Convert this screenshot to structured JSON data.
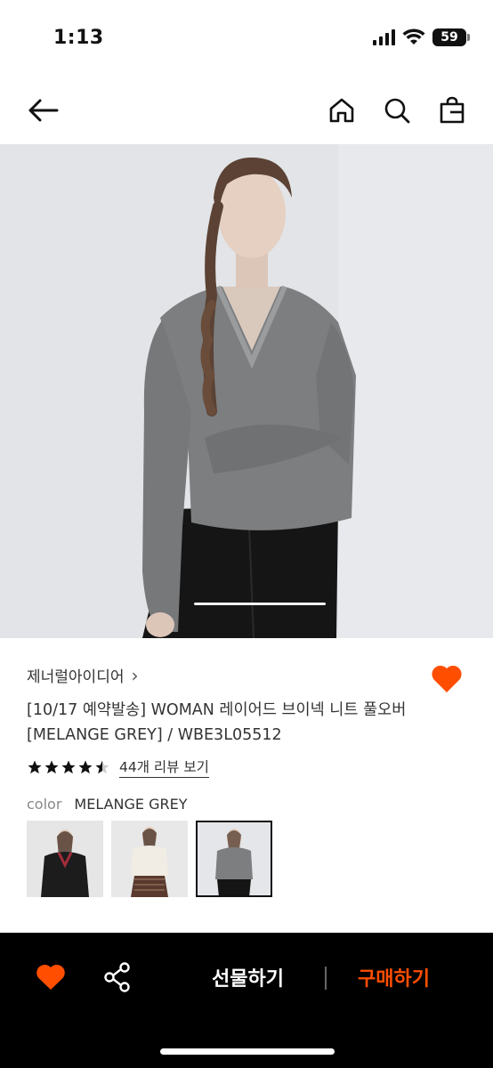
{
  "status_bar": {
    "time": "1:13",
    "battery": "59",
    "icons": [
      "signal-icon",
      "wifi-icon",
      "battery-icon"
    ]
  },
  "nav": {
    "icons": [
      "back-arrow-icon",
      "home-icon",
      "search-icon",
      "shopping-bag-icon"
    ]
  },
  "product": {
    "brand": "제너럴아이디어",
    "brand_chevron": "›",
    "title": "[10/17 예약발송] WOMAN 레이어드 브이넥 니트 풀오버 [MELANGE GREY] / WBE3L05512",
    "rating": 4.5,
    "review_link": "44개 리뷰 보기",
    "color_label": "color",
    "color_value": "MELANGE GREY",
    "thumbnails": [
      "black",
      "ivory",
      "melange-grey"
    ],
    "selected_thumbnail": 2,
    "hero_page_indicator": 1
  },
  "bottom_bar": {
    "gift_label": "선물하기",
    "buy_label": "구매하기",
    "icons": [
      "heart-icon",
      "share-icon"
    ]
  },
  "colors": {
    "accent": "#ff4e00",
    "bottom_bar_bg": "#000000"
  }
}
